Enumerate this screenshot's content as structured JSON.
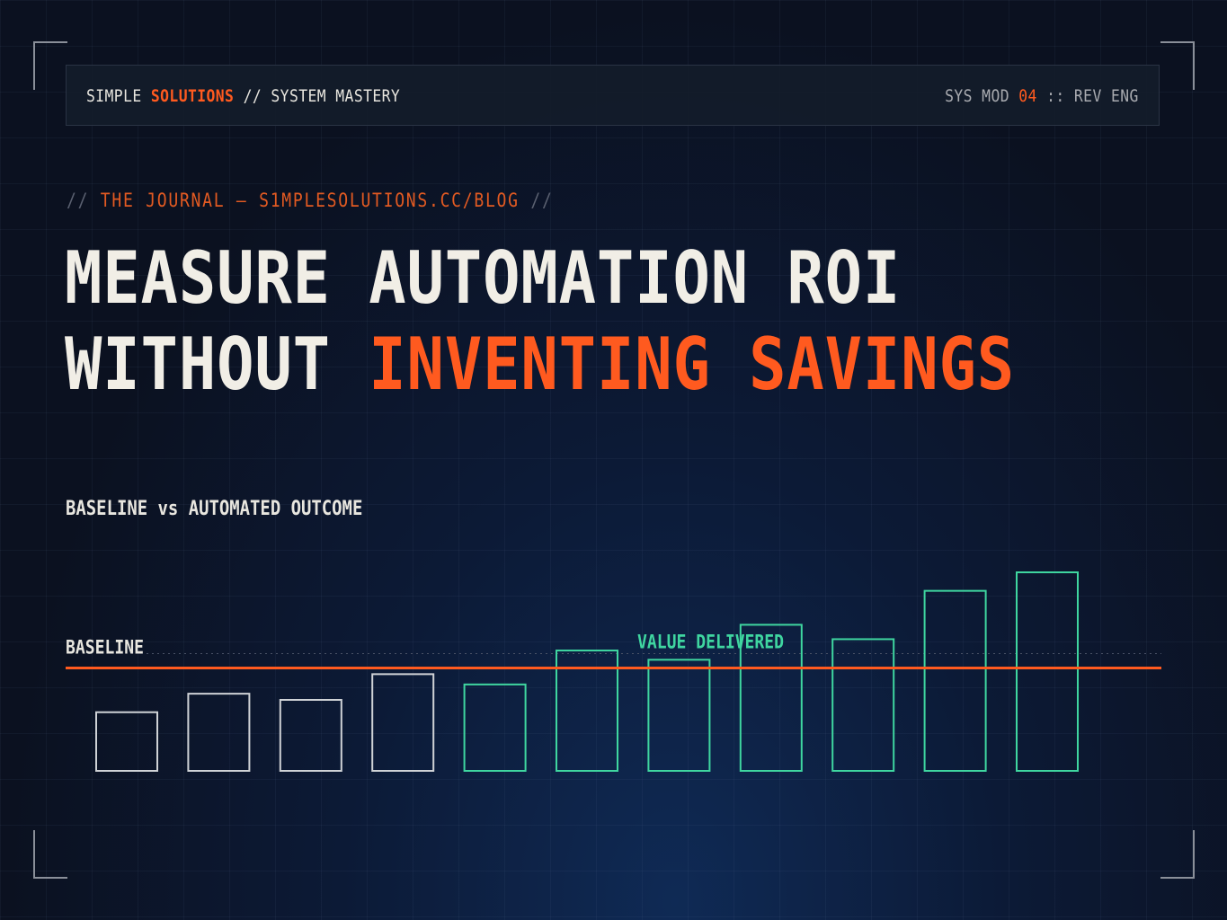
{
  "header": {
    "brand_primary": "SIMPLE",
    "brand_accent": "SOLUTIONS",
    "brand_sep": "//",
    "brand_secondary": "SYSTEM MASTERY",
    "module_prefix": "SYS MOD",
    "module_number": "04",
    "module_sep": "::",
    "module_suffix": "REV ENG"
  },
  "kicker": {
    "left_slash": "//",
    "text": "THE JOURNAL — S1MPLESOLUTIONS.CC/BLOG",
    "right_slash": "//"
  },
  "title": {
    "line1": "MEASURE AUTOMATION ROI",
    "line2_plain": "WITHOUT",
    "line2_accent": "INVENTING SAVINGS"
  },
  "chart_label": "BASELINE vs AUTOMATED OUTCOME",
  "chart_data": {
    "type": "bar",
    "title": "BASELINE vs AUTOMATED OUTCOME",
    "baseline_label": "BASELINE",
    "annotation": "VALUE DELIVERED",
    "baseline_value": 1.0,
    "values": [
      0.57,
      0.75,
      0.69,
      0.94,
      0.84,
      1.17,
      1.08,
      1.42,
      1.28,
      1.75,
      1.93
    ],
    "phases": [
      "before",
      "before",
      "before",
      "before",
      "after",
      "after",
      "after",
      "after",
      "after",
      "after",
      "after"
    ],
    "ylim": [
      0,
      2.0
    ],
    "colors": {
      "before": "#cfd2d6",
      "after": "#3fd6a0",
      "baseline": "#ff5a1f",
      "annotation": "#3fd6a0"
    }
  },
  "colors": {
    "accent": "#ff5a1f",
    "background": "#0b1120",
    "text": "#f1eee6"
  }
}
